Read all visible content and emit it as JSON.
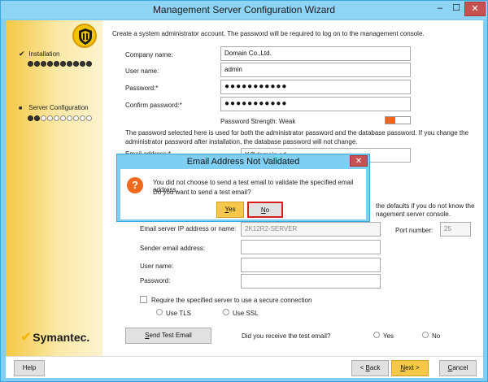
{
  "window": {
    "title": "Management Server Configuration Wizard",
    "min_glyph": "–",
    "max_glyph": "☐",
    "close_glyph": "✕"
  },
  "sidebar": {
    "steps": [
      {
        "label": "Installation",
        "status": "complete",
        "mark": "✔",
        "total_dots": 10,
        "filled_dots": 10
      },
      {
        "label": "Server Configuration",
        "status": "current",
        "mark": "■",
        "total_dots": 10,
        "filled_dots": 2
      }
    ],
    "logo_text": "Symantec.",
    "logo_mark": "✔"
  },
  "form": {
    "intro": "Create a system administrator account. The password will be required to log on to the management console.",
    "company_label": "Company name:",
    "company_value": "Domain Co.,Ltd.",
    "username_label": "User name:",
    "username_value": "admin",
    "password_label": "Password:*",
    "password_value": "●●●●●●●●●●●",
    "confirm_label": "Confirm password:*",
    "confirm_value": "●●●●●●●●●●●",
    "strength_label": "Password Strength: Weak",
    "strength_fraction": 0.4,
    "note": "The password selected here is used for both the administrator password and the database password. If you change the administrator password after installation, the database password will not change.",
    "email_label": "Email address:*",
    "email_value": "Y@domain.ad",
    "partial_line_1": "the defaults if you do not know the",
    "partial_line_2": "nagement server console.",
    "smtp_label": "Email server IP address or name:",
    "smtp_value": "2K12R2-SERVER",
    "port_label": "Port number:",
    "port_value": "25",
    "sender_label": "Sender email address:",
    "smtp_user_label": "User name:",
    "smtp_password_label": "Password:",
    "secure_label": "Require the specified server to use a secure connection",
    "tls_label": "Use TLS",
    "ssl_label": "Use SSL",
    "send_test_label": "Send Test Email",
    "received_label": "Did you receive the test email?",
    "yes_label": "Yes",
    "no_label": "No"
  },
  "footer": {
    "help_label": "Help",
    "back_label": "< Back",
    "next_label": "Next >",
    "cancel_label": "Cancel"
  },
  "dialog": {
    "title": "Email Address Not Validated",
    "close_glyph": "✕",
    "icon_glyph": "?",
    "message_1": "You did not choose to send a test email to validate the specified email address.",
    "message_2": "Do you want to send a test email?",
    "yes_label": "Yes",
    "no_label": "No"
  }
}
